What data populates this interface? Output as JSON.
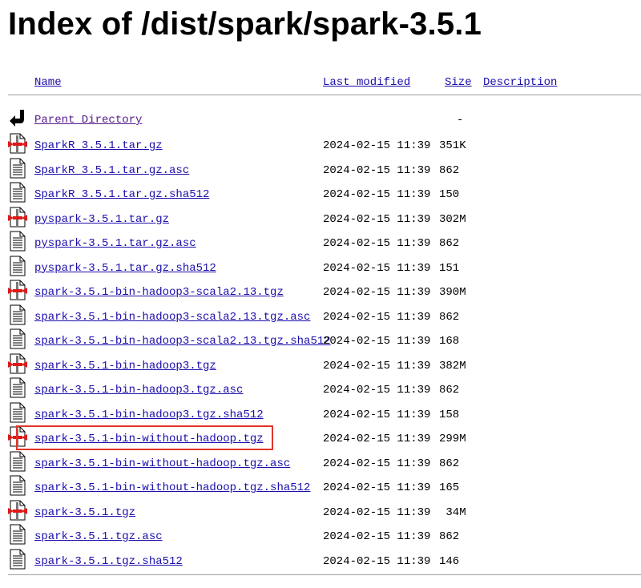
{
  "page": {
    "title": "Index of /dist/spark/spark-3.5.1"
  },
  "columns": {
    "name": "Name",
    "last_modified": "Last modified",
    "size": "Size",
    "description": "Description"
  },
  "parent": {
    "name": "Parent Directory",
    "size": "-"
  },
  "files": [
    {
      "name": "SparkR_3.5.1.tar.gz",
      "date": "2024-02-15 11:39",
      "size": "351K",
      "icon": "archive-icon"
    },
    {
      "name": "SparkR_3.5.1.tar.gz.asc",
      "date": "2024-02-15 11:39",
      "size": "862",
      "icon": "text-file-icon"
    },
    {
      "name": "SparkR_3.5.1.tar.gz.sha512",
      "date": "2024-02-15 11:39",
      "size": "150",
      "icon": "text-file-icon"
    },
    {
      "name": "pyspark-3.5.1.tar.gz",
      "date": "2024-02-15 11:39",
      "size": "302M",
      "icon": "archive-icon"
    },
    {
      "name": "pyspark-3.5.1.tar.gz.asc",
      "date": "2024-02-15 11:39",
      "size": "862",
      "icon": "text-file-icon"
    },
    {
      "name": "pyspark-3.5.1.tar.gz.sha512",
      "date": "2024-02-15 11:39",
      "size": "151",
      "icon": "text-file-icon"
    },
    {
      "name": "spark-3.5.1-bin-hadoop3-scala2.13.tgz",
      "date": "2024-02-15 11:39",
      "size": "390M",
      "icon": "archive-icon"
    },
    {
      "name": "spark-3.5.1-bin-hadoop3-scala2.13.tgz.asc",
      "date": "2024-02-15 11:39",
      "size": "862",
      "icon": "text-file-icon"
    },
    {
      "name": "spark-3.5.1-bin-hadoop3-scala2.13.tgz.sha512",
      "date": "2024-02-15 11:39",
      "size": "168",
      "icon": "text-file-icon"
    },
    {
      "name": "spark-3.5.1-bin-hadoop3.tgz",
      "date": "2024-02-15 11:39",
      "size": "382M",
      "icon": "archive-icon"
    },
    {
      "name": "spark-3.5.1-bin-hadoop3.tgz.asc",
      "date": "2024-02-15 11:39",
      "size": "862",
      "icon": "text-file-icon"
    },
    {
      "name": "spark-3.5.1-bin-hadoop3.tgz.sha512",
      "date": "2024-02-15 11:39",
      "size": "158",
      "icon": "text-file-icon"
    },
    {
      "name": "spark-3.5.1-bin-without-hadoop.tgz",
      "date": "2024-02-15 11:39",
      "size": "299M",
      "icon": "archive-icon"
    },
    {
      "name": "spark-3.5.1-bin-without-hadoop.tgz.asc",
      "date": "2024-02-15 11:39",
      "size": "862",
      "icon": "text-file-icon"
    },
    {
      "name": "spark-3.5.1-bin-without-hadoop.tgz.sha512",
      "date": "2024-02-15 11:39",
      "size": "165",
      "icon": "text-file-icon"
    },
    {
      "name": "spark-3.5.1.tgz",
      "date": "2024-02-15 11:39",
      "size": " 34M",
      "icon": "archive-icon"
    },
    {
      "name": "spark-3.5.1.tgz.asc",
      "date": "2024-02-15 11:39",
      "size": "862",
      "icon": "text-file-icon"
    },
    {
      "name": "spark-3.5.1.tgz.sha512",
      "date": "2024-02-15 11:39",
      "size": "146",
      "icon": "text-file-icon"
    }
  ],
  "colors": {
    "link": "#1a0dab",
    "visited": "#551a8b",
    "highlight": "#e0352b"
  }
}
